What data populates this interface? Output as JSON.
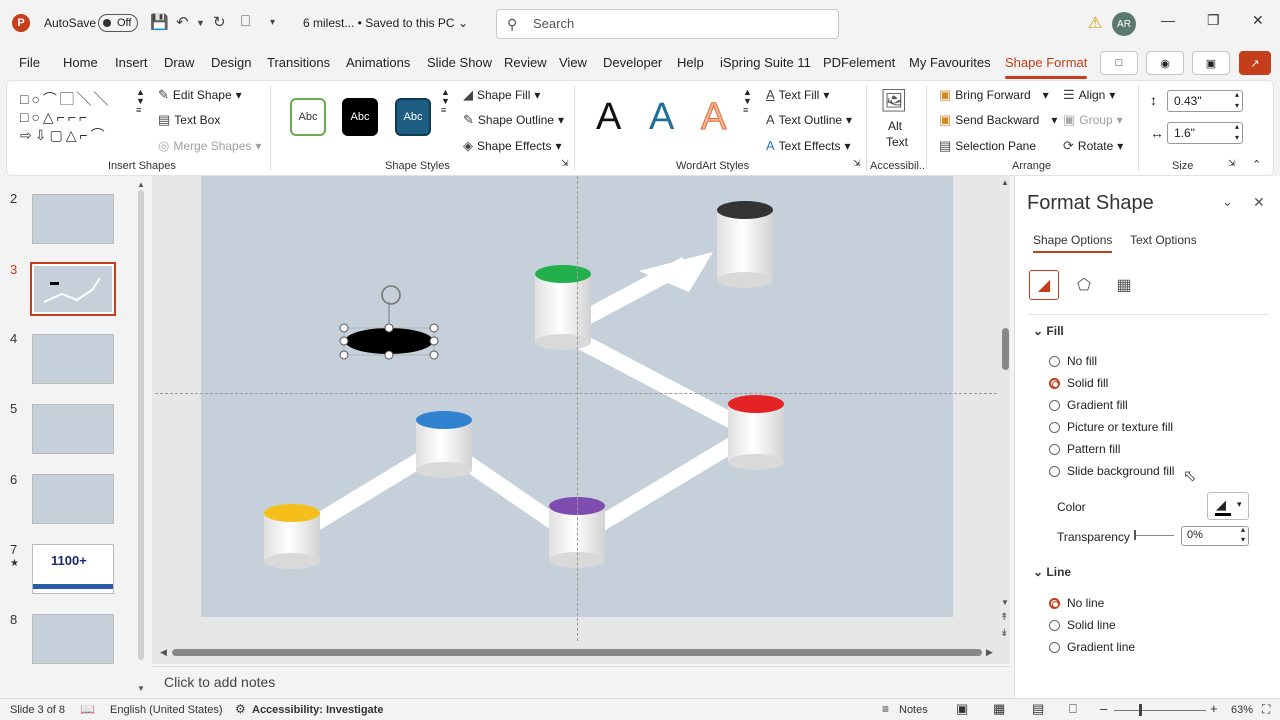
{
  "titlebar": {
    "autosave_label": "AutoSave",
    "autosave_state": "Off",
    "doc_title": "6 milest... • Saved to this PC",
    "search_placeholder": "Search",
    "avatar_initials": "AR"
  },
  "menu": [
    "File",
    "Home",
    "Insert",
    "Draw",
    "Design",
    "Transitions",
    "Animations",
    "Slide Show",
    "Review",
    "View",
    "Developer",
    "Help",
    "iSpring Suite 11",
    "PDFelement",
    "My Favourites",
    "Shape Format"
  ],
  "ribbon": {
    "insert_shapes": {
      "label": "Insert Shapes",
      "edit_shape": "Edit Shape",
      "text_box": "Text Box",
      "merge_shapes": "Merge Shapes"
    },
    "shape_styles": {
      "label": "Shape Styles",
      "sample": "Abc",
      "shape_fill": "Shape Fill",
      "shape_outline": "Shape Outline",
      "shape_effects": "Shape Effects"
    },
    "wordart_styles": {
      "label": "WordArt Styles",
      "letter": "A",
      "text_fill": "Text Fill",
      "text_outline": "Text Outline",
      "text_effects": "Text Effects"
    },
    "accessibility": {
      "label": "Accessibil...",
      "alt_text_line1": "Alt",
      "alt_text_line2": "Text"
    },
    "arrange": {
      "label": "Arrange",
      "bring_forward": "Bring Forward",
      "send_backward": "Send Backward",
      "selection_pane": "Selection Pane",
      "align": "Align",
      "group": "Group",
      "rotate": "Rotate"
    },
    "size": {
      "label": "Size",
      "height": "0.43\"",
      "width": "1.6\""
    }
  },
  "slides": [
    {
      "num": "2"
    },
    {
      "num": "3"
    },
    {
      "num": "4"
    },
    {
      "num": "5"
    },
    {
      "num": "6"
    },
    {
      "num": "7"
    },
    {
      "num": "8"
    }
  ],
  "thumb7_text": "1100+",
  "notes_placeholder": "Click to add notes",
  "format_pane": {
    "title": "Format Shape",
    "tab_shape": "Shape Options",
    "tab_text": "Text Options",
    "fill_section": "Fill",
    "fill_options": [
      "No fill",
      "Solid fill",
      "Gradient fill",
      "Picture or texture fill",
      "Pattern fill",
      "Slide background fill"
    ],
    "fill_selected": "Solid fill",
    "color_label": "Color",
    "transparency_label": "Transparency",
    "transparency_value": "0%",
    "line_section": "Line",
    "line_options": [
      "No line",
      "Solid line",
      "Gradient line"
    ],
    "line_selected": "No line"
  },
  "status": {
    "slide_info": "Slide 3 of 8",
    "language": "English (United States)",
    "accessibility": "Accessibility: Investigate",
    "notes": "Notes",
    "zoom": "63%"
  },
  "colors": {
    "accent": "#c43e1c",
    "slide_bg": "#c5d0db"
  }
}
